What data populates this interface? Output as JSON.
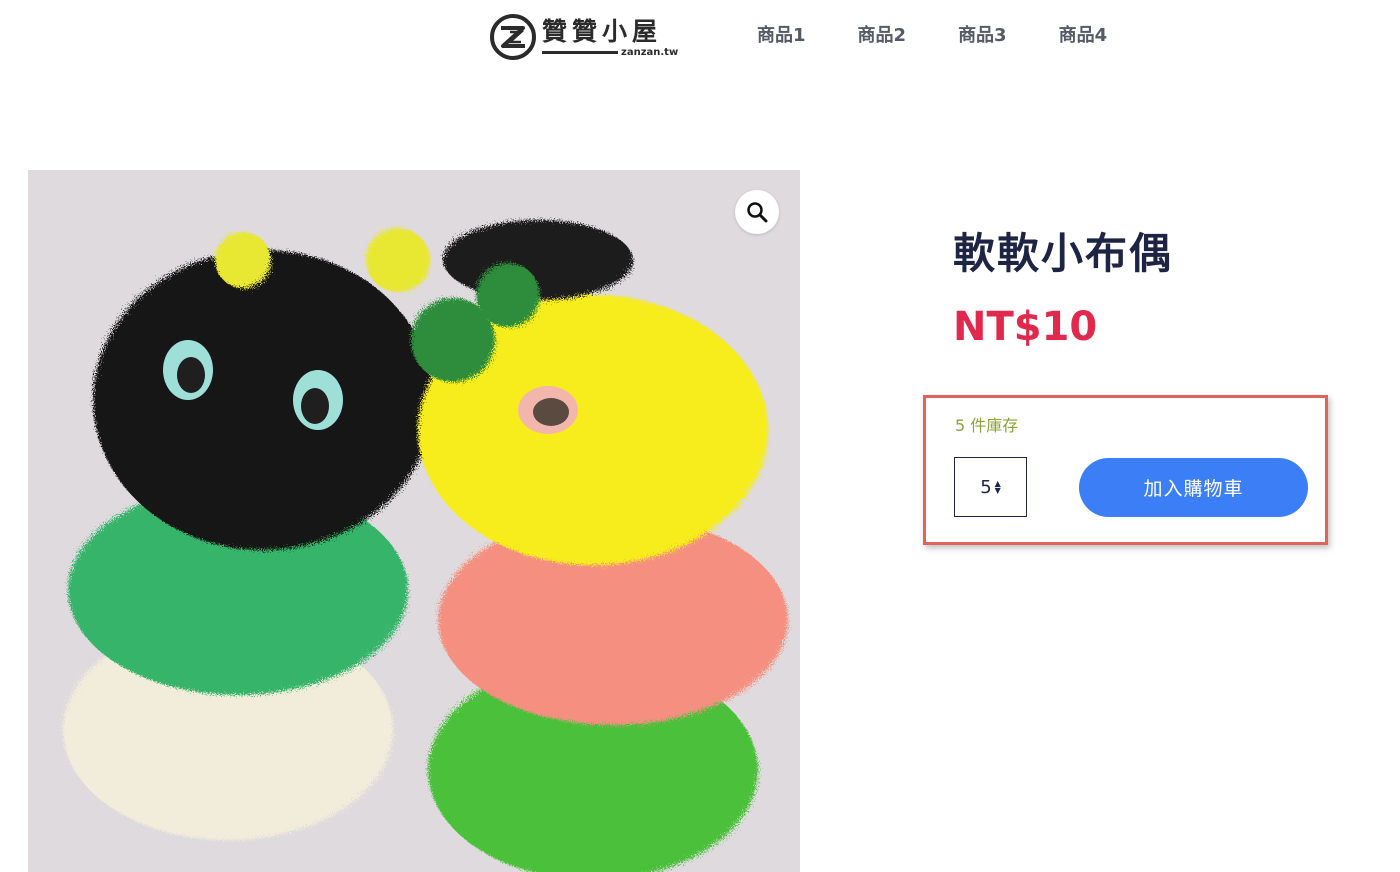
{
  "header": {
    "site_name": "贊贊小屋",
    "site_domain": "zanzan.tw",
    "nav": [
      {
        "label": "商品1"
      },
      {
        "label": "商品2"
      },
      {
        "label": "商品3"
      },
      {
        "label": "商品4"
      }
    ]
  },
  "product": {
    "title": "軟軟小布偶",
    "price": "NT$10",
    "stock_text": "5 件庫存",
    "quantity": "5",
    "add_to_cart_label": "加入購物車",
    "zoom_icon": "magnifier-icon"
  },
  "colors": {
    "title": "#1e2444",
    "price": "#e0294d",
    "stock": "#8aa23a",
    "button": "#3b7ef5",
    "highlight_border": "#e0645a"
  }
}
